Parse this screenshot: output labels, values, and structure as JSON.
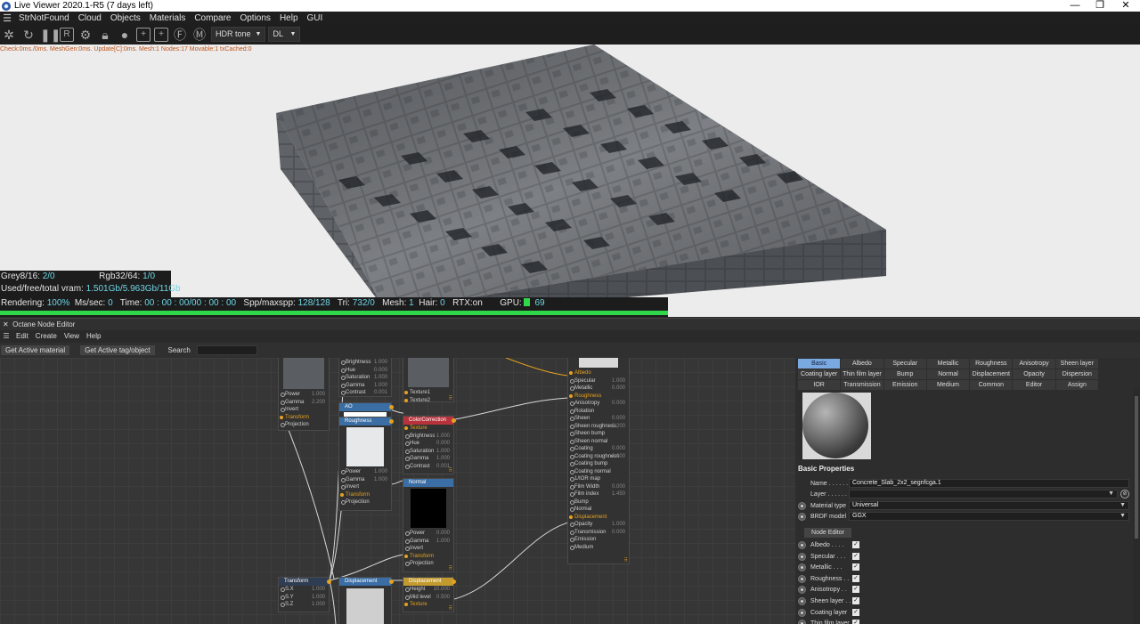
{
  "window": {
    "title": "Live Viewer 2020.1-R5 (7 days left)",
    "controls": [
      "—",
      "❐",
      "✕"
    ]
  },
  "menu": [
    "StrNotFound",
    "Cloud",
    "Objects",
    "Materials",
    "Compare",
    "Options",
    "Help",
    "GUI"
  ],
  "toolbar": {
    "icons": [
      "octane-logo-icon",
      "restart-icon",
      "pause-icon",
      "render-region-icon",
      "settings-gear-icon",
      "lock-icon",
      "sphere-icon",
      "add-object-icon",
      "add-layer-icon",
      "film-icon",
      "mask-icon"
    ],
    "tone_select": "HDR tone",
    "dl_select": "DL"
  },
  "viewport": {
    "stats_line": "Check:0ms./0ms. MeshGen:0ms. Update[C]:0ms. Mesh:1 Nodes:17 Movable:1 txCached:0",
    "grey_label": "Grey8/16:",
    "grey_value": "2/0",
    "rgb_label": "Rgb32/64:",
    "rgb_value": "1/0",
    "vram_label": "Used/free/total vram:",
    "vram_value": "1.501Gb/5.963Gb/11Gb"
  },
  "render_status": {
    "rendering_label": "Rendering:",
    "rendering_value": "100%",
    "ms_label": "Ms/sec:",
    "ms_value": "0",
    "time_label": "Time:",
    "time_value": "00 : 00 : 00/00 : 00 : 00",
    "spp_label": "Spp/maxspp:",
    "spp_value": "128/128",
    "tri_label": "Tri:",
    "tri_value": "732/0",
    "mesh_label": "Mesh:",
    "mesh_value": "1",
    "hair_label": "Hair:",
    "hair_value": "0",
    "rtx_label": "RTX:on",
    "gpu_label": "GPU:",
    "gpu_value": "69",
    "progress": 1.0
  },
  "node_editor": {
    "title": "Octane Node Editor",
    "menu": [
      "Edit",
      "Create",
      "View",
      "Help"
    ],
    "get_material": "Get Active material",
    "get_tag": "Get Active tag/object",
    "search_label": "Search",
    "nodes": {
      "img1": {
        "rows": [
          [
            "Power",
            "1.000"
          ],
          [
            "Gamma",
            "2.200"
          ],
          [
            "Invert",
            ""
          ],
          [
            "Transform",
            ""
          ],
          [
            "Projection",
            ""
          ]
        ]
      },
      "cc_top": {
        "rows": [
          [
            "Brightness",
            "1.000"
          ],
          [
            "Hue",
            "0.000"
          ],
          [
            "Saturation",
            "1.000"
          ],
          [
            "Gamma",
            "1.000"
          ],
          [
            "Contrast",
            "0.001"
          ]
        ]
      },
      "ao": {
        "title": "AO"
      },
      "roughness": {
        "title": "Roughness",
        "rows": [
          [
            "Power",
            "1.000"
          ],
          [
            "Gamma",
            "1.000"
          ],
          [
            "Invert",
            ""
          ],
          [
            "Transform",
            ""
          ],
          [
            "Projection",
            ""
          ]
        ]
      },
      "mix_pins": [
        "Texture1",
        "Texture2"
      ],
      "colorcorrection": {
        "title": "ColorCorrection",
        "rows": [
          [
            "Texture",
            ""
          ],
          [
            "Brightness",
            "1.000"
          ],
          [
            "Hue",
            "0.000"
          ],
          [
            "Saturation",
            "1.000"
          ],
          [
            "Gamma",
            "1.000"
          ],
          [
            "Contrast",
            "0.001"
          ]
        ]
      },
      "normal": {
        "title": "Normal",
        "rows": [
          [
            "Power",
            "0.000"
          ],
          [
            "Gamma",
            "1.000"
          ],
          [
            "Invert",
            ""
          ],
          [
            "Transform",
            ""
          ],
          [
            "Projection",
            ""
          ]
        ]
      },
      "material": {
        "rows": [
          [
            "Albedo",
            ""
          ],
          [
            "Specular",
            "1.000"
          ],
          [
            "Metallic",
            "0.000"
          ],
          [
            "Roughness",
            ""
          ],
          [
            "Anisotropy",
            "0.000"
          ],
          [
            "Rotation",
            ""
          ],
          [
            "Sheen",
            "0.000"
          ],
          [
            "Sheen roughness",
            "0.200"
          ],
          [
            "Sheen bump",
            ""
          ],
          [
            "Sheen normal",
            ""
          ],
          [
            "Coating",
            "0.000"
          ],
          [
            "Coating roughness",
            "0.000"
          ],
          [
            "Coating bump",
            ""
          ],
          [
            "Coating normal",
            ""
          ],
          [
            "1/IOR map",
            ""
          ],
          [
            "Film Width",
            "0.000"
          ],
          [
            "Film index",
            "1.450"
          ],
          [
            "Bump",
            ""
          ],
          [
            "Normal",
            ""
          ],
          [
            "Displacement",
            ""
          ],
          [
            "Opacity",
            "1.000"
          ],
          [
            "Transmission",
            "0.000"
          ],
          [
            "Emission",
            ""
          ],
          [
            "Medium",
            ""
          ]
        ]
      },
      "transform": {
        "title": "Transform",
        "rows": [
          [
            "S.X",
            "1.000"
          ],
          [
            "S.Y",
            "1.000"
          ],
          [
            "S.Z",
            "1.000"
          ]
        ]
      },
      "displacement_img": {
        "title": "Displacement"
      },
      "displacement": {
        "title": "Displacement",
        "rows": [
          [
            "Height",
            "10.000"
          ],
          [
            "Mid level",
            "0.500"
          ],
          [
            "Texture",
            ""
          ]
        ]
      }
    }
  },
  "properties": {
    "tabs": [
      "Basic",
      "Albedo",
      "Specular",
      "Metallic",
      "Roughness",
      "Anisotropy",
      "Sheen layer",
      "Coating layer",
      "Thin film layer",
      "Bump",
      "Normal",
      "Displacement",
      "Opacity",
      "Dispersion",
      "IOR",
      "Transmission",
      "Emission",
      "Medium",
      "Common",
      "Editor",
      "Assign"
    ],
    "active_tab": "Basic",
    "section_title": "Basic Properties",
    "name_label": "Name . . . . . .",
    "name_value": "Concrete_Slab_2x2_segnfcga.1",
    "layer_label": "Layer . . . . . .",
    "material_type_label": "Material type",
    "material_type_value": "Universal",
    "brdf_label": "BRDF model",
    "brdf_value": "GGX",
    "node_editor_button": "Node Editor",
    "checks": [
      {
        "label": "Albedo . . . .",
        "checked": true
      },
      {
        "label": "Specular . . .",
        "checked": true
      },
      {
        "label": "Metallic . . .",
        "checked": true
      },
      {
        "label": "Roughness . .",
        "checked": true
      },
      {
        "label": "Anisotropy . .",
        "checked": true
      },
      {
        "label": "Sheen layer . .",
        "checked": true
      },
      {
        "label": "Coating layer",
        "checked": true
      },
      {
        "label": "Thin film layer",
        "checked": true
      }
    ]
  }
}
